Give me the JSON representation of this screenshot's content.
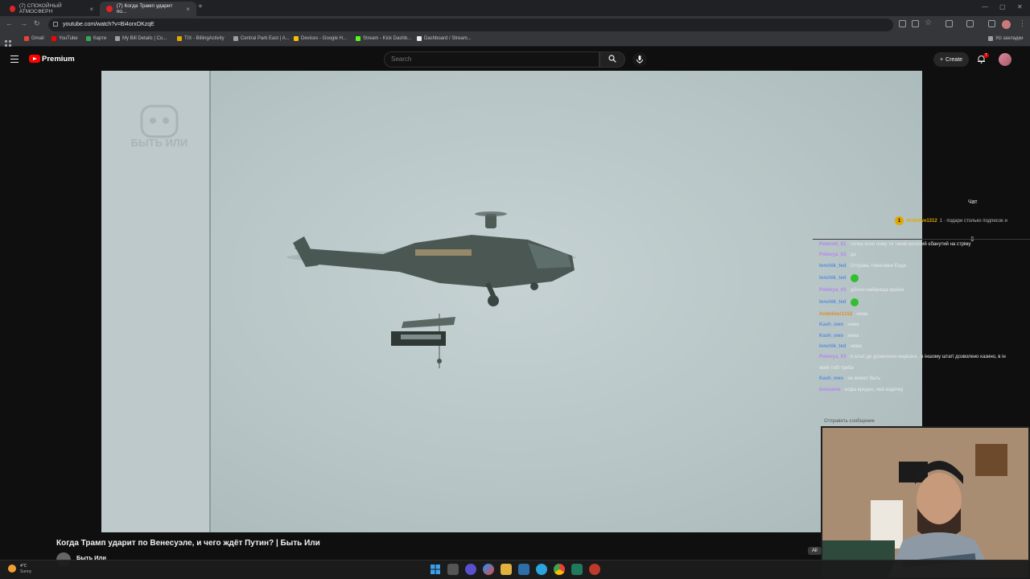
{
  "browser": {
    "tabs": [
      {
        "title": "(7) СПОКОЙНЫЙ АТМОСФЕРН"
      },
      {
        "title": "(7) Когда Трамп ударит по..."
      }
    ],
    "new_tab": "+",
    "url": "youtube.com/watch?v=Bi4orxOKzqE",
    "bookmarks": [
      "Gmail",
      "YouTube",
      "Карти",
      "My Bill Details | Co...",
      "TIX - BillingActivity",
      "Central Park East | A...",
      "Devices - Google H...",
      "Stream - Kick Dashb...",
      "Dashboard / Stream..."
    ],
    "all_bookmarks": "Усі закладки"
  },
  "masthead": {
    "logo": "Premium",
    "search_placeholder": "Search",
    "create": "Create",
    "notifications": "7"
  },
  "video": {
    "title": "Когда Трамп ударит по Венесуэле, и чего ждёт Путин? | Быть Или",
    "channel": "Быть Или",
    "watermark": "БЫТЬ ИЛИ"
  },
  "chat": {
    "title": "Чат",
    "pinned_user": "Andolive1312",
    "pinned_text": "1 · подари столько подписок и",
    "messages": [
      {
        "user": "Paterski_01",
        "text": ": тепер ясно чому ти такий веселий єбанутий на стріму",
        "color": "#b784f0"
      },
      {
        "user": "Pokerya_03",
        "text": ": да",
        "color": "#b784f0"
      },
      {
        "user": "Ionchik_ted",
        "text": ": Отправь томагавки Енди",
        "color": "#5b8de0"
      },
      {
        "user": "Ionchik_ted",
        "text": ":",
        "color": "#5b8de0",
        "emote": true
      },
      {
        "user": "Pokerya_03",
        "text": ": дійсно найкраща країна",
        "color": "#b784f0"
      },
      {
        "user": "Ionchik_ted",
        "text": ":",
        "color": "#5b8de0",
        "emote": true
      },
      {
        "user": "Andoliver1312",
        "text": ": нема",
        "color": "#e08a2a"
      },
      {
        "user": "Kash_owo",
        "text": ": нема",
        "color": "#5b8de0"
      },
      {
        "user": "Kash_owo",
        "text": ": нема",
        "color": "#5b8de0"
      },
      {
        "user": "Ionchik_ted",
        "text": ": нема",
        "color": "#5b8de0"
      },
      {
        "user": "Pokerya_03",
        "text": ": в штат де дозволено марішка , в іншому штаті дозволено казино, в ін",
        "color": "#b784f0"
      },
      {
        "user": "",
        "text": "який тобі треба",
        "color": "#e8e8e8"
      },
      {
        "user": "Kash_owo",
        "text": ": не может быть",
        "color": "#5b8de0"
      },
      {
        "user": "bonsalvo",
        "text": ": кофа вредно, пей водичку",
        "color": "#b784f0"
      }
    ],
    "send_placeholder": "Отправить сообщение",
    "all_chip": "All"
  },
  "taskbar": {
    "weather_temp": "4°C",
    "weather_desc": "Sunny"
  }
}
